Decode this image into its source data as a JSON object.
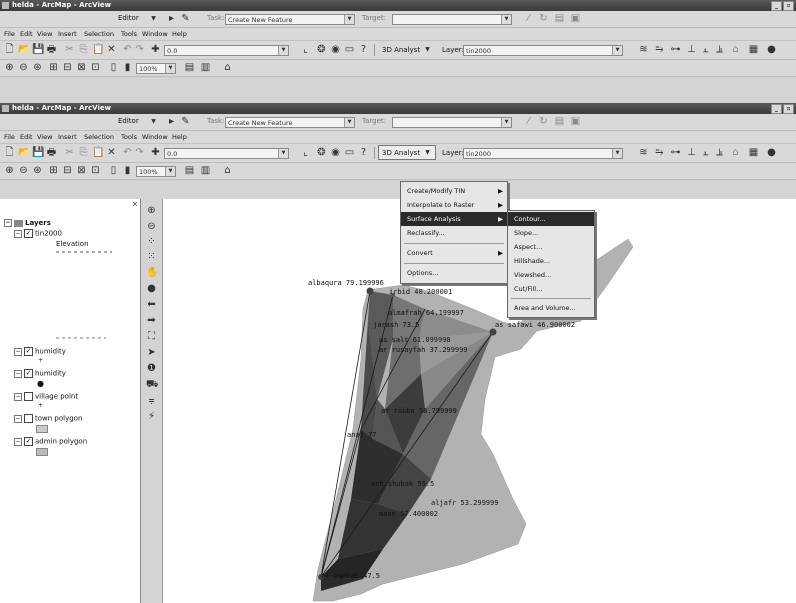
{
  "window_back": {
    "title": "helda - ArcMap - ArcView",
    "editor_label": "Editor",
    "task_label": "Task:",
    "task_value": "Create New Feature",
    "target_label": "Target:",
    "menu": [
      "File",
      "Edit",
      "View",
      "Insert",
      "Selection",
      "Tools",
      "Window",
      "Help"
    ],
    "scale_value": "0.0",
    "analyst_label": "3D Analyst",
    "layer_label": "Layer:",
    "layer_value": "tin2000",
    "zoom_value": "100%"
  },
  "window_front": {
    "title": "helda - ArcMap - ArcView",
    "editor_label": "Editor",
    "task_label": "Task:",
    "task_value": "Create New Feature",
    "target_label": "Target:",
    "menu": [
      "File",
      "Edit",
      "View",
      "Insert",
      "Selection",
      "Tools",
      "Window",
      "Help"
    ],
    "scale_value": "0.0",
    "analyst_label": "3D Analyst",
    "layer_label": "Layer:",
    "layer_value": "tin2000",
    "zoom_value": "100%"
  },
  "toc": {
    "root": "Layers",
    "items": [
      "tin2000",
      "Elevation",
      "humidity",
      "humidity",
      "village point",
      "town polygon",
      "admin polygon"
    ]
  },
  "analyst_menu": [
    "Create/Modify TIN",
    "Interpolate to Raster",
    "Surface Analysis",
    "Reclassify...",
    "Convert",
    "Options..."
  ],
  "surface_menu": [
    "Contour...",
    "Slope...",
    "Aspect...",
    "Hillshade...",
    "Viewshed...",
    "Cut/Fill...",
    "Area and Volume..."
  ],
  "map_labels": [
    "albaqura 79.199996",
    "irbid 40.200001",
    "almafrah 64.199997",
    "jarash 73.5",
    "as salt 61.099998",
    "az zarqa 37.299999",
    "ar rusayfah 37.299999",
    "as safawi 46.900002",
    "ar rabba 58.799999",
    "anat 77",
    "ash shubak 59.5",
    "aljafr 53.299999",
    "maan 57.400002",
    "al aqabah 47.5"
  ],
  "colors": {
    "title_bg": "#3a3a3a",
    "highlight": "#2a2a2a",
    "land_gray": "#b0b0b0",
    "tin_dark": "#333333"
  }
}
